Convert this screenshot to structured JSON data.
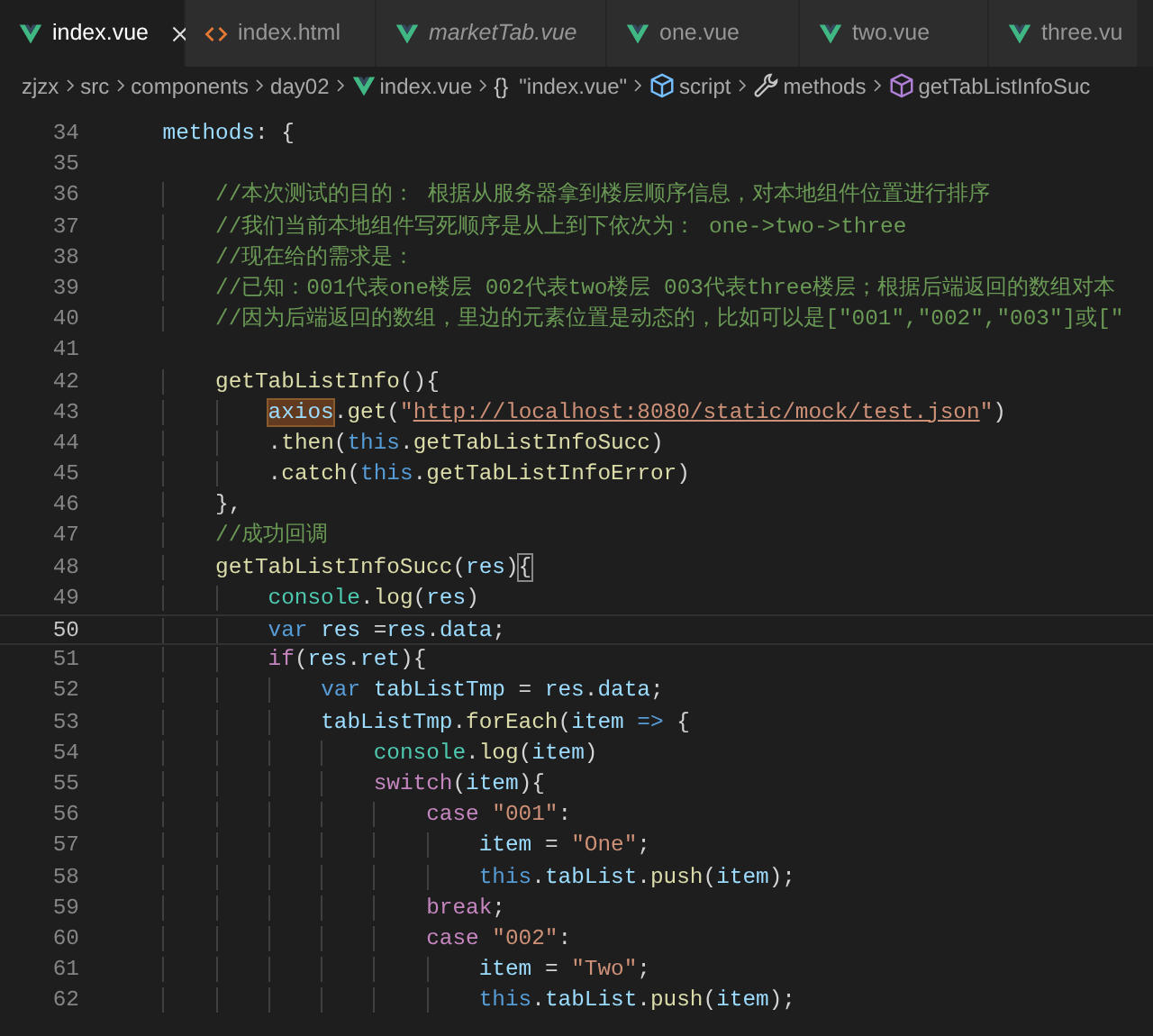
{
  "tabs": [
    {
      "label": "index.vue",
      "kind": "vue",
      "selected": true,
      "preview": false,
      "closable": true
    },
    {
      "label": "index.html",
      "kind": "html",
      "selected": false,
      "preview": false,
      "closable": false
    },
    {
      "label": "marketTab.vue",
      "kind": "vue",
      "selected": false,
      "preview": true,
      "closable": false
    },
    {
      "label": "one.vue",
      "kind": "vue",
      "selected": false,
      "preview": false,
      "closable": false
    },
    {
      "label": "two.vue",
      "kind": "vue",
      "selected": false,
      "preview": false,
      "closable": false
    },
    {
      "label": "three.vu",
      "kind": "vue",
      "selected": false,
      "preview": false,
      "closable": false
    }
  ],
  "breadcrumbs": [
    {
      "label": "zjzx",
      "kind": "folder"
    },
    {
      "label": "src",
      "kind": "folder"
    },
    {
      "label": "components",
      "kind": "folder"
    },
    {
      "label": "day02",
      "kind": "folder"
    },
    {
      "label": "index.vue",
      "kind": "vue"
    },
    {
      "label": "\"index.vue\"",
      "kind": "braces",
      "icon_text": "{}"
    },
    {
      "label": "script",
      "kind": "module"
    },
    {
      "label": "methods",
      "kind": "wrench"
    },
    {
      "label": "getTabListInfoSuc",
      "kind": "method"
    }
  ],
  "code_lines": [
    {
      "number": "34",
      "current": false,
      "tokens": [
        {
          "kind": "v",
          "text": "    methods"
        },
        {
          "kind": "p",
          "text": ": {"
        }
      ]
    },
    {
      "number": "35",
      "current": false
    },
    {
      "number": "36",
      "current": false,
      "tokens": [
        {
          "kind": "c",
          "text": "        //本次测试的目的： 根据从服务器拿到楼层顺序信息，对本地组件位置进行排序"
        }
      ]
    },
    {
      "number": "37",
      "current": false,
      "tokens": [
        {
          "kind": "c",
          "text": "        //我们当前本地组件写死顺序是从上到下依次为： one->two->three"
        }
      ]
    },
    {
      "number": "38",
      "current": false,
      "tokens": [
        {
          "kind": "c",
          "text": "        //现在给的需求是："
        }
      ]
    },
    {
      "number": "39",
      "current": false,
      "tokens": [
        {
          "kind": "c",
          "text": "        //已知：001代表one楼层 002代表two楼层 003代表three楼层；根据后端返回的数组对本"
        }
      ]
    },
    {
      "number": "40",
      "current": false,
      "tokens": [
        {
          "kind": "c",
          "text": "        //因为后端返回的数组，里边的元素位置是动态的，比如可以是[\"001\",\"002\",\"003\"]或[\""
        }
      ]
    },
    {
      "number": "41",
      "current": false
    },
    {
      "number": "42",
      "current": false,
      "tokens": [
        {
          "kind": "fn",
          "text": "        getTabListInfo"
        },
        {
          "kind": "p",
          "text": "(){"
        }
      ]
    },
    {
      "number": "43",
      "current": false,
      "tokens": [
        {
          "kind": "hl",
          "text": "            axios"
        },
        {
          "kind": "p",
          "text": "."
        },
        {
          "kind": "fn",
          "text": "get"
        },
        {
          "kind": "p",
          "text": "("
        },
        {
          "kind": "str",
          "text": "\""
        },
        {
          "kind": "link",
          "text": "http://localhost:8080/static/mock/test.json"
        },
        {
          "kind": "str",
          "text": "\""
        },
        {
          "kind": "p",
          "text": ")"
        }
      ]
    },
    {
      "number": "44",
      "current": false,
      "tokens": [
        {
          "kind": "p",
          "text": "            ."
        },
        {
          "kind": "fn",
          "text": "then"
        },
        {
          "kind": "p",
          "text": "("
        },
        {
          "kind": "s",
          "text": "this"
        },
        {
          "kind": "p",
          "text": "."
        },
        {
          "kind": "fn",
          "text": "getTabListInfoSucc"
        },
        {
          "kind": "p",
          "text": ")"
        }
      ]
    },
    {
      "number": "45",
      "current": false,
      "tokens": [
        {
          "kind": "p",
          "text": "            ."
        },
        {
          "kind": "fn",
          "text": "catch"
        },
        {
          "kind": "p",
          "text": "("
        },
        {
          "kind": "s",
          "text": "this"
        },
        {
          "kind": "p",
          "text": "."
        },
        {
          "kind": "fn",
          "text": "getTabListInfoError"
        },
        {
          "kind": "p",
          "text": ")"
        }
      ]
    },
    {
      "number": "46",
      "current": false,
      "tokens": [
        {
          "kind": "p",
          "text": "        },"
        }
      ]
    },
    {
      "number": "47",
      "current": false,
      "tokens": [
        {
          "kind": "c",
          "text": "        //成功回调"
        }
      ]
    },
    {
      "number": "48",
      "current": false,
      "tokens": [
        {
          "kind": "fn",
          "text": "        getTabListInfoSucc"
        },
        {
          "kind": "p",
          "text": "("
        },
        {
          "kind": "v",
          "text": "res"
        },
        {
          "kind": "p",
          "text": ")"
        },
        {
          "kind": "br",
          "text": "{"
        }
      ]
    },
    {
      "number": "49",
      "current": false,
      "tokens": [
        {
          "kind": "t",
          "text": "            console"
        },
        {
          "kind": "p",
          "text": "."
        },
        {
          "kind": "fn",
          "text": "log"
        },
        {
          "kind": "p",
          "text": "("
        },
        {
          "kind": "v",
          "text": "res"
        },
        {
          "kind": "p",
          "text": ")"
        }
      ]
    },
    {
      "number": "50",
      "current": true,
      "tokens": [
        {
          "kind": "s",
          "text": "            var"
        },
        {
          "kind": "v",
          "text": " res"
        },
        {
          "kind": "p",
          "text": " ="
        },
        {
          "kind": "v",
          "text": "res"
        },
        {
          "kind": "p",
          "text": "."
        },
        {
          "kind": "v",
          "text": "data"
        },
        {
          "kind": "p",
          "text": ";"
        }
      ]
    },
    {
      "number": "51",
      "current": false,
      "tokens": [
        {
          "kind": "k",
          "text": "            if"
        },
        {
          "kind": "p",
          "text": "("
        },
        {
          "kind": "v",
          "text": "res"
        },
        {
          "kind": "p",
          "text": "."
        },
        {
          "kind": "v",
          "text": "ret"
        },
        {
          "kind": "p",
          "text": "){"
        }
      ]
    },
    {
      "number": "52",
      "current": false,
      "tokens": [
        {
          "kind": "s",
          "text": "                var"
        },
        {
          "kind": "v",
          "text": " tabListTmp"
        },
        {
          "kind": "p",
          "text": " = "
        },
        {
          "kind": "v",
          "text": "res"
        },
        {
          "kind": "p",
          "text": "."
        },
        {
          "kind": "v",
          "text": "data"
        },
        {
          "kind": "p",
          "text": ";"
        }
      ]
    },
    {
      "number": "53",
      "current": false,
      "tokens": [
        {
          "kind": "v",
          "text": "                tabListTmp"
        },
        {
          "kind": "p",
          "text": "."
        },
        {
          "kind": "fn",
          "text": "forEach"
        },
        {
          "kind": "p",
          "text": "("
        },
        {
          "kind": "v",
          "text": "item"
        },
        {
          "kind": "s",
          "text": " =>"
        },
        {
          "kind": "p",
          "text": " {"
        }
      ]
    },
    {
      "number": "54",
      "current": false,
      "tokens": [
        {
          "kind": "t",
          "text": "                    console"
        },
        {
          "kind": "p",
          "text": "."
        },
        {
          "kind": "fn",
          "text": "log"
        },
        {
          "kind": "p",
          "text": "("
        },
        {
          "kind": "v",
          "text": "item"
        },
        {
          "kind": "p",
          "text": ")"
        }
      ]
    },
    {
      "number": "55",
      "current": false,
      "tokens": [
        {
          "kind": "k",
          "text": "                    switch"
        },
        {
          "kind": "p",
          "text": "("
        },
        {
          "kind": "v",
          "text": "item"
        },
        {
          "kind": "p",
          "text": "){"
        }
      ]
    },
    {
      "number": "56",
      "current": false,
      "tokens": [
        {
          "kind": "k",
          "text": "                        case"
        },
        {
          "kind": "str",
          "text": " \"001\""
        },
        {
          "kind": "p",
          "text": ":"
        }
      ]
    },
    {
      "number": "57",
      "current": false,
      "tokens": [
        {
          "kind": "v",
          "text": "                            item"
        },
        {
          "kind": "p",
          "text": " = "
        },
        {
          "kind": "str",
          "text": "\"One\""
        },
        {
          "kind": "p",
          "text": ";"
        }
      ]
    },
    {
      "number": "58",
      "current": false,
      "tokens": [
        {
          "kind": "s",
          "text": "                            this"
        },
        {
          "kind": "p",
          "text": "."
        },
        {
          "kind": "v",
          "text": "tabList"
        },
        {
          "kind": "p",
          "text": "."
        },
        {
          "kind": "fn",
          "text": "push"
        },
        {
          "kind": "p",
          "text": "("
        },
        {
          "kind": "v",
          "text": "item"
        },
        {
          "kind": "p",
          "text": ");"
        }
      ]
    },
    {
      "number": "59",
      "current": false,
      "tokens": [
        {
          "kind": "k",
          "text": "                        break"
        },
        {
          "kind": "p",
          "text": ";"
        }
      ]
    },
    {
      "number": "60",
      "current": false,
      "tokens": [
        {
          "kind": "k",
          "text": "                        case"
        },
        {
          "kind": "str",
          "text": " \"002\""
        },
        {
          "kind": "p",
          "text": ":"
        }
      ]
    },
    {
      "number": "61",
      "current": false,
      "tokens": [
        {
          "kind": "v",
          "text": "                            item"
        },
        {
          "kind": "p",
          "text": " = "
        },
        {
          "kind": "str",
          "text": "\"Two\""
        },
        {
          "kind": "p",
          "text": ";"
        }
      ]
    },
    {
      "number": "62",
      "current": false,
      "tokens": [
        {
          "kind": "s",
          "text": "                            this"
        },
        {
          "kind": "p",
          "text": "."
        },
        {
          "kind": "v",
          "text": "tabList"
        },
        {
          "kind": "p",
          "text": "."
        },
        {
          "kind": "fn",
          "text": "push"
        },
        {
          "kind": "p",
          "text": "("
        },
        {
          "kind": "v",
          "text": "item"
        },
        {
          "kind": "p",
          "text": ");"
        }
      ]
    }
  ]
}
